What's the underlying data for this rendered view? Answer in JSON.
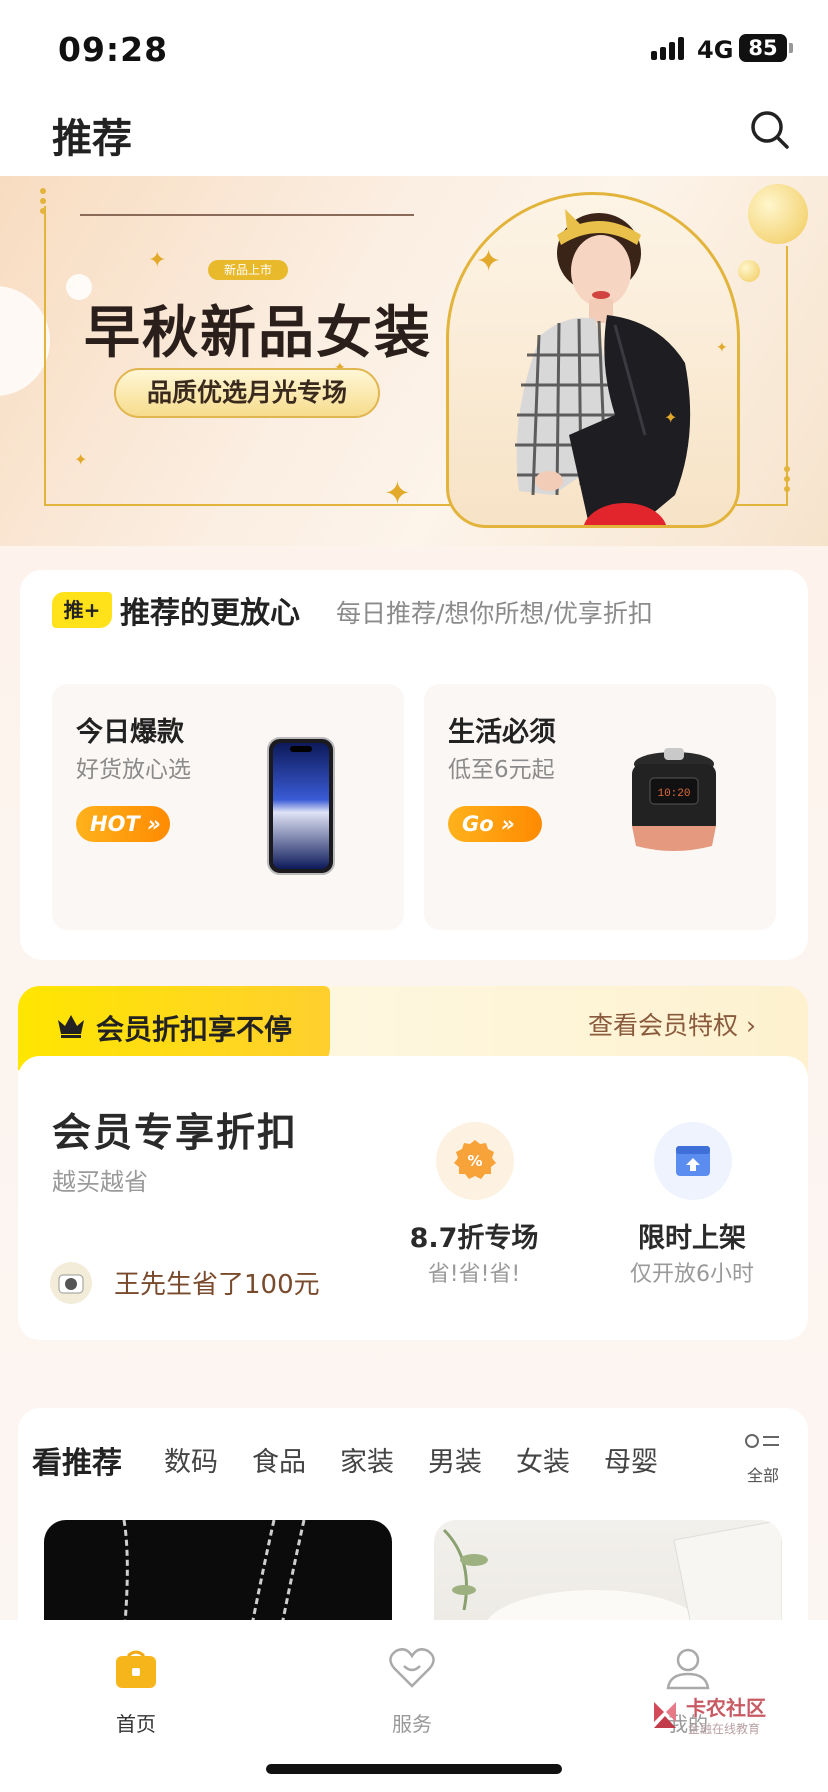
{
  "status_bar": {
    "time": "09:28",
    "network": "4G",
    "battery": "85"
  },
  "header": {
    "title": "推荐",
    "search_icon": "search-icon"
  },
  "banner": {
    "tag": "新品上市",
    "title": "早秋新品女装",
    "subtitle": "品质优选月光专场"
  },
  "recommend": {
    "badge": "推+",
    "title": "推荐的更放心",
    "subtitle": "每日推荐/想你所想/优享折扣",
    "deals": [
      {
        "title": "今日爆款",
        "sub": "好货放心选",
        "pill": "HOT",
        "image": "smartphone"
      },
      {
        "title": "生活必须",
        "sub": "低至6元起",
        "pill": "Go",
        "image": "pressure-cooker"
      }
    ]
  },
  "member": {
    "tab_label": "会员折扣享不停",
    "link": "查看会员特权 ›",
    "title": "会员专享折扣",
    "sub": "越买越省",
    "saver": "王先生省了100元",
    "perks": [
      {
        "title": "8.7折专场",
        "sub": "省!省!省!",
        "icon": "percent-badge-icon",
        "color": "#f7a33a"
      },
      {
        "title": "限时上架",
        "sub": "仅开放6小时",
        "icon": "shelf-upload-icon",
        "color": "#5b8cf0"
      }
    ]
  },
  "feed": {
    "tabs": [
      "看推荐",
      "数码",
      "食品",
      "家装",
      "男装",
      "女装",
      "母婴"
    ],
    "all_label": "全部"
  },
  "tab_bar": {
    "items": [
      {
        "label": "首页",
        "icon": "home-bag-icon"
      },
      {
        "label": "服务",
        "icon": "heart-icon"
      },
      {
        "label": "我的",
        "icon": "user-icon"
      }
    ]
  },
  "watermark": {
    "title": "卡农社区",
    "sub": "金融在线教育"
  },
  "colors": {
    "accent_yellow": "#ffe21a",
    "gold": "#e3b43b",
    "orange": "#ff8a00"
  }
}
